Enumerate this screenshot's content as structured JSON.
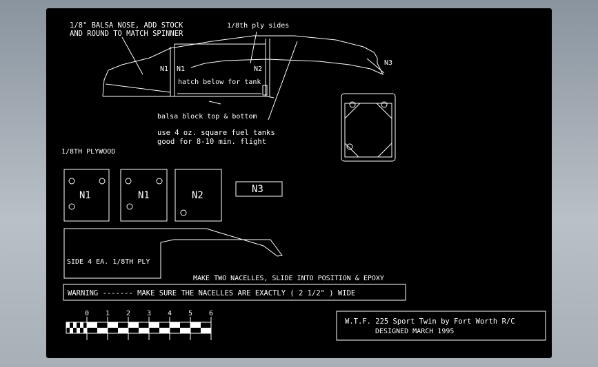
{
  "notes": {
    "nose_line1": "1/8\" BALSA NOSE,  ADD STOCK",
    "nose_line2": "AND ROUND TO MATCH SPINNER",
    "ply_sides": "1/8th  ply  sides",
    "hatch": "hatch below for tank",
    "balsa_block": "balsa block top & bottom",
    "tanks_line1": "use 4 oz. square fuel tanks",
    "tanks_line2": "good for 8-10 min. flight",
    "plywood": "1/8TH PLYWOOD",
    "side_label": "SIDE   4 EA.  1/8TH   PLY",
    "make_two": "MAKE TWO NACELLES, SLIDE INTO POSITION & EPOXY",
    "warning": "WARNING -------  MAKE SURE THE NACELLES ARE EXACTLY ( 2   1/2\" ) WIDE"
  },
  "labels": {
    "n1_a": "N1",
    "n1_b": "N1",
    "n2": "N2",
    "n3": "N3"
  },
  "parts": {
    "n1_a": "N1",
    "n1_b": "N1",
    "n2": "N2",
    "n3": "N3"
  },
  "scale": {
    "ticks": [
      "0",
      "1",
      "2",
      "3",
      "4",
      "5",
      "6"
    ]
  },
  "title_block": {
    "line1": "W.T.F.  225   Sport Twin by Fort Worth R/C",
    "line2": "DESIGNED   MARCH   1995"
  }
}
